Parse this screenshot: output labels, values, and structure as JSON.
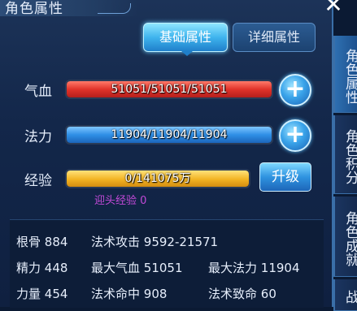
{
  "window": {
    "title": "角色属性",
    "close_icon": "close-x-icon"
  },
  "tabs": {
    "basic": "基础属性",
    "detail": "详细属性"
  },
  "stats": {
    "hp": {
      "label": "气血",
      "text": "51051/51051/51051",
      "fill": 1.0
    },
    "mp": {
      "label": "法力",
      "text": "11904/11904/11904",
      "fill": 1.0
    },
    "exp": {
      "label": "经验",
      "text": "0/141075万",
      "fill": 1.0
    }
  },
  "buttons": {
    "upgrade": "升级",
    "plus_icon": "plus-icon"
  },
  "welcome_exp": "迎头经验  0",
  "attributes": {
    "row1": [
      {
        "name": "根骨",
        "value": "884"
      },
      {
        "name": "法术攻击",
        "value": "9592-21571"
      }
    ],
    "row2": [
      {
        "name": "精力",
        "value": "448"
      },
      {
        "name": "最大气血",
        "value": "51051"
      },
      {
        "name": "最大法力",
        "value": "11904"
      }
    ],
    "row3": [
      {
        "name": "力量",
        "value": "454"
      },
      {
        "name": "法术命中",
        "value": "908"
      },
      {
        "name": "法术致命",
        "value": "60"
      }
    ]
  },
  "side_tabs": [
    "角色属性",
    "角色积分",
    "角色成就",
    "战"
  ],
  "colors": {
    "hp_bar": "#e0332a",
    "mp_bar": "#2f8fe6",
    "exp_bar": "#f2b322",
    "welcome_exp": "#c34ad8",
    "accent": "#3fb4ee"
  }
}
